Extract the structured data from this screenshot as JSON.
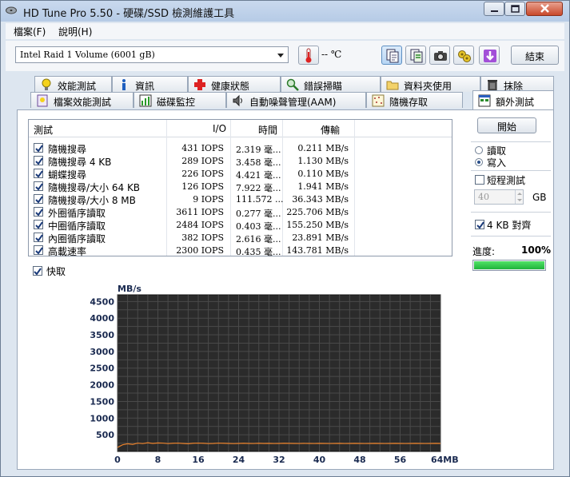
{
  "window": {
    "title": "HD Tune Pro 5.50 - 硬碟/SSD 檢測維護工具"
  },
  "menu": [
    "檔案(F)",
    "說明(H)"
  ],
  "toolbar": {
    "drive": "Intel   Raid 1 Volume (6001 gB)",
    "temperature": "-- ℃",
    "exit_label": "結束"
  },
  "tabs_row1": [
    "效能測試",
    "資訊",
    "健康狀態",
    "錯誤掃瞄",
    "資料夾使用",
    "抹除"
  ],
  "tabs_row2": [
    "檔案效能測試",
    "磁碟監控",
    "自動噪聲管理(AAM)",
    "隨機存取",
    "額外測試"
  ],
  "table": {
    "headers": [
      "測試",
      "I/O",
      "時間",
      "傳輸"
    ],
    "rows": [
      {
        "name": "隨機搜尋",
        "io": "431 IOPS",
        "time": "2.319 毫...",
        "transfer": "0.211 MB/s"
      },
      {
        "name": "隨機搜尋 4 KB",
        "io": "289 IOPS",
        "time": "3.458 毫...",
        "transfer": "1.130 MB/s"
      },
      {
        "name": "蝴蝶搜尋",
        "io": "226 IOPS",
        "time": "4.421 毫...",
        "transfer": "0.110 MB/s"
      },
      {
        "name": "隨機搜尋/大小 64 KB",
        "io": "126 IOPS",
        "time": "7.922 毫...",
        "transfer": "1.941 MB/s"
      },
      {
        "name": "隨機搜尋/大小 8 MB",
        "io": "9 IOPS",
        "time": "111.572 ...",
        "transfer": "36.343 MB/s"
      },
      {
        "name": "外圈循序讀取",
        "io": "3611 IOPS",
        "time": "0.277 毫...",
        "transfer": "225.706 MB/s"
      },
      {
        "name": "中圈循序讀取",
        "io": "2484 IOPS",
        "time": "0.403 毫...",
        "transfer": "155.250 MB/s"
      },
      {
        "name": "內圈循序讀取",
        "io": "382 IOPS",
        "time": "2.616 毫...",
        "transfer": "23.891 MB/s"
      },
      {
        "name": "高載速率",
        "io": "2300 IOPS",
        "time": "0.435 毫...",
        "transfer": "143.781 MB/s"
      }
    ]
  },
  "cache_label": "快取",
  "right_panel": {
    "start_label": "開始",
    "read_label": "讀取",
    "write_label": "寫入",
    "short_test_label": "短程測試",
    "size_value": "40",
    "size_unit": "GB",
    "align_label": "4 KB 對齊",
    "progress_label": "進度:",
    "progress_value": "100%",
    "progress_fraction": 1.0
  },
  "chart_data": {
    "type": "line",
    "ylabel": "MB/s",
    "xunit": "MB",
    "y_ticks": [
      500,
      1000,
      1500,
      2000,
      2500,
      3000,
      3500,
      4000,
      4500
    ],
    "x_ticks": [
      "0",
      "8",
      "16",
      "24",
      "32",
      "40",
      "48",
      "56",
      "64MB"
    ],
    "xlim": [
      0,
      64
    ],
    "ylim": [
      0,
      4700
    ],
    "grid": true,
    "series": [
      {
        "color": "#e8802a",
        "x": [
          0,
          0.5,
          1,
          2,
          3,
          4,
          5,
          6,
          7,
          8,
          9,
          10,
          11,
          12,
          13,
          14,
          15,
          16,
          17,
          18,
          19,
          20,
          21,
          22,
          23,
          24,
          25,
          26,
          27,
          28,
          29,
          30,
          31,
          32,
          33,
          34,
          35,
          36,
          37,
          38,
          39,
          40,
          41,
          42,
          43,
          44,
          45,
          46,
          47,
          48,
          49,
          50,
          51,
          52,
          53,
          54,
          55,
          56,
          57,
          58,
          59,
          60,
          61,
          62,
          63,
          64
        ],
        "values": [
          120,
          160,
          200,
          230,
          210,
          250,
          235,
          260,
          240,
          255,
          250,
          235,
          245,
          250,
          240,
          230,
          245,
          250,
          245,
          235,
          240,
          250,
          245,
          240,
          235,
          240,
          245,
          240,
          238,
          245,
          240,
          242,
          238,
          240,
          245,
          242,
          240,
          238,
          242,
          240,
          238,
          242,
          240,
          238,
          240,
          242,
          238,
          240,
          242,
          240,
          238,
          240,
          242,
          240,
          238,
          240,
          242,
          240,
          238,
          240,
          242,
          240,
          238,
          240,
          242,
          240
        ]
      }
    ]
  }
}
